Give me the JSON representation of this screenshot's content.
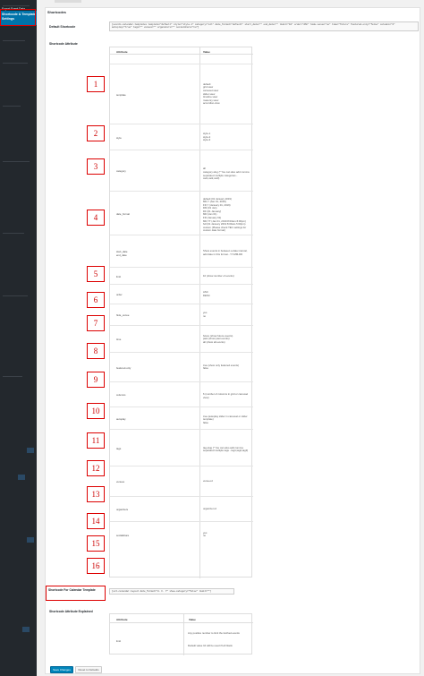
{
  "sidebar": {
    "small_items": [
      "Export Event Data"
    ],
    "active_item": "Shortcode & Template Settings"
  },
  "page": {
    "section_title": "Shortcodes",
    "default_shortcode_label": "Default Shortcode",
    "default_shortcode_value": "[events-calendar-templates template=\"default\" style=\"style-1\" category=\"all\" date_format=\"default\" start_date=\"\" end_date=\"\" limit=\"10\" order=\"ASC\" hide-venue=\"no\" time=\"future\" featured-only=\"false\" columns=\"2\" autoplay=\"true\" tags=\"\" venues=\"\" organizers=\"\" socialshare=\"no\"]",
    "attribute_label": "Shortcode Attribute"
  },
  "table": {
    "col_attribute": "Attribute",
    "col_value": "Value",
    "rows": [
      {
        "num": "1",
        "attr": "template",
        "values": [
          "default",
          "grid-view",
          "carousel-view",
          "slider-view",
          "timeline-view",
          "masonry-view",
          "accordion-view"
        ]
      },
      {
        "num": "2",
        "attr": "style",
        "values": [
          "style-1",
          "style-2",
          "style-3"
        ]
      },
      {
        "num": "3",
        "attr": "category",
        "values": [
          "all",
          "category-slug (* You can also add comma separated multiple categories - cat1,cat2,cat3)"
        ]
      },
      {
        "num": "4",
        "attr": "date_format",
        "values": [
          "default (01 January 2019)",
          "MD,Y (Jan 01, 2019)",
          "FD,Y (January 01, 2019)",
          "DM (01 Jan)",
          "DF (01 January)",
          "MD (Jan 01)",
          "FD (January 01)",
          "MD,YT (Jan 01, 2019 8:00am-5:00pm)",
          "full (01 January 2019 8:00am-5:00pm)",
          "custom (Please check TEC settings for custom date format)"
        ]
      },
      {
        "num": "5",
        "attr": "start_date\nend_date",
        "values": [
          "Show events in between a date interval, add date in this format - YY-MM-DD"
        ]
      },
      {
        "num": "6",
        "attr": "limit",
        "values": [
          "10 (show number of events)"
        ]
      },
      {
        "num": "7",
        "attr": "order",
        "values": [
          "ASC",
          "DESC"
        ]
      },
      {
        "num": "8",
        "attr": "hide_venue",
        "values": [
          "yes",
          "no"
        ]
      },
      {
        "num": "9",
        "attr": "time",
        "values": [
          "future (show future events)",
          "past (show past events)",
          "all (show all events)"
        ]
      },
      {
        "num": "10",
        "attr": "featured-only",
        "values": [
          "true (show only featured events)",
          "false"
        ]
      },
      {
        "num": "11",
        "attr": "columns",
        "values": [
          "6 (number of columns in grid or carousel view)"
        ]
      },
      {
        "num": "12",
        "attr": "autoplay",
        "values": [
          "true (autoplay slider in carousel or slider template)",
          "false"
        ]
      },
      {
        "num": "13",
        "attr": "tags",
        "values": [
          "tag-slug (* You can also add comma separated multiple tags - tag1,tag2,tag3)"
        ]
      },
      {
        "num": "14",
        "attr": "venues",
        "values": [
          "venue-id"
        ]
      },
      {
        "num": "15",
        "attr": "organizers",
        "values": [
          "organizer-id"
        ]
      },
      {
        "num": "16",
        "attr": "socialshare",
        "values": [
          "yes",
          "no"
        ]
      }
    ]
  },
  "calendar": {
    "label": "Shortcode For Calendar Template",
    "value": "[ect-calendar-layout date_format=\"d. F. Y\" show-category=\"false\" limit=\"\"]",
    "explained_label": "Shortcode Attribute Explained",
    "col_attribute": "Attribute",
    "col_value": "Value",
    "row_attr": "limit",
    "row_values": [
      "Any positive number to limit the fetched events",
      "Default value 10 will be used if left blank"
    ]
  },
  "buttons": {
    "save": "Save Changes",
    "reset": "Reset to Defaults"
  },
  "colors": {
    "highlight": "#d00000",
    "sidebar": "#23282d",
    "active": "#0073aa"
  }
}
